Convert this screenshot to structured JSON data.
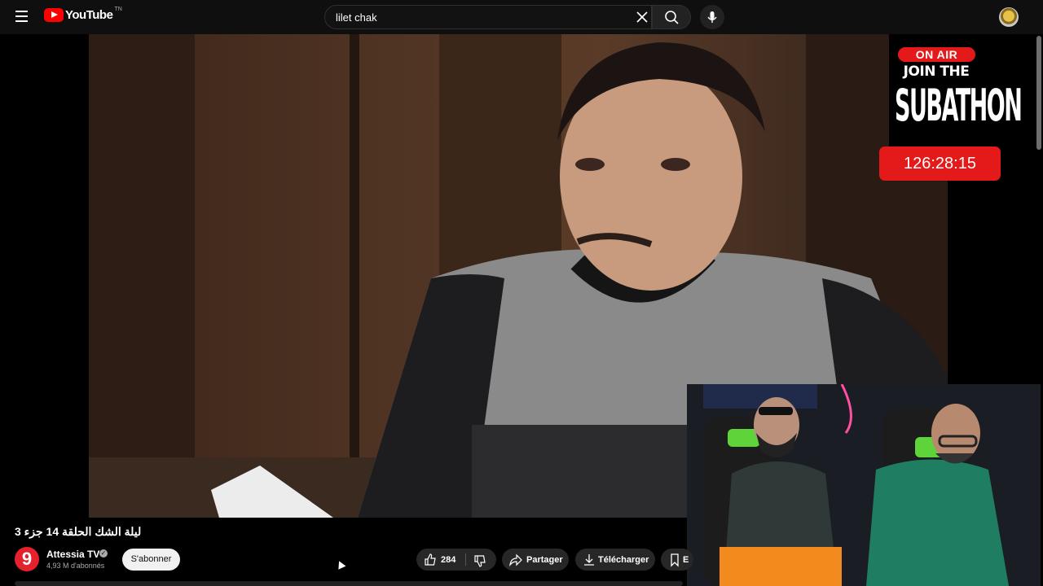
{
  "header": {
    "logo_text": "YouTube",
    "logo_suffix": "TN",
    "search_value": "lilet chak",
    "icons": [
      "menu-icon",
      "clear-icon",
      "search-icon",
      "mic-icon",
      "avatar"
    ]
  },
  "overlay": {
    "badge": "ON AIR",
    "line1": "JOIN THE",
    "line2": "SUBATHON",
    "timer": "126:28:15"
  },
  "video_info": {
    "title": "ليلة الشك الحلقة 14 جزء 3",
    "channel_logo": "9",
    "channel_name": "Attessia TV",
    "subscribers": "4,93 M d'abonnés",
    "subscribe_label": "S'abonner"
  },
  "actions": {
    "like_count": "284",
    "share_label": "Partager",
    "download_label": "Télécharger",
    "save_partial": "E"
  },
  "colors": {
    "accent_red": "#e3191a",
    "background": "#0f0f0f"
  }
}
